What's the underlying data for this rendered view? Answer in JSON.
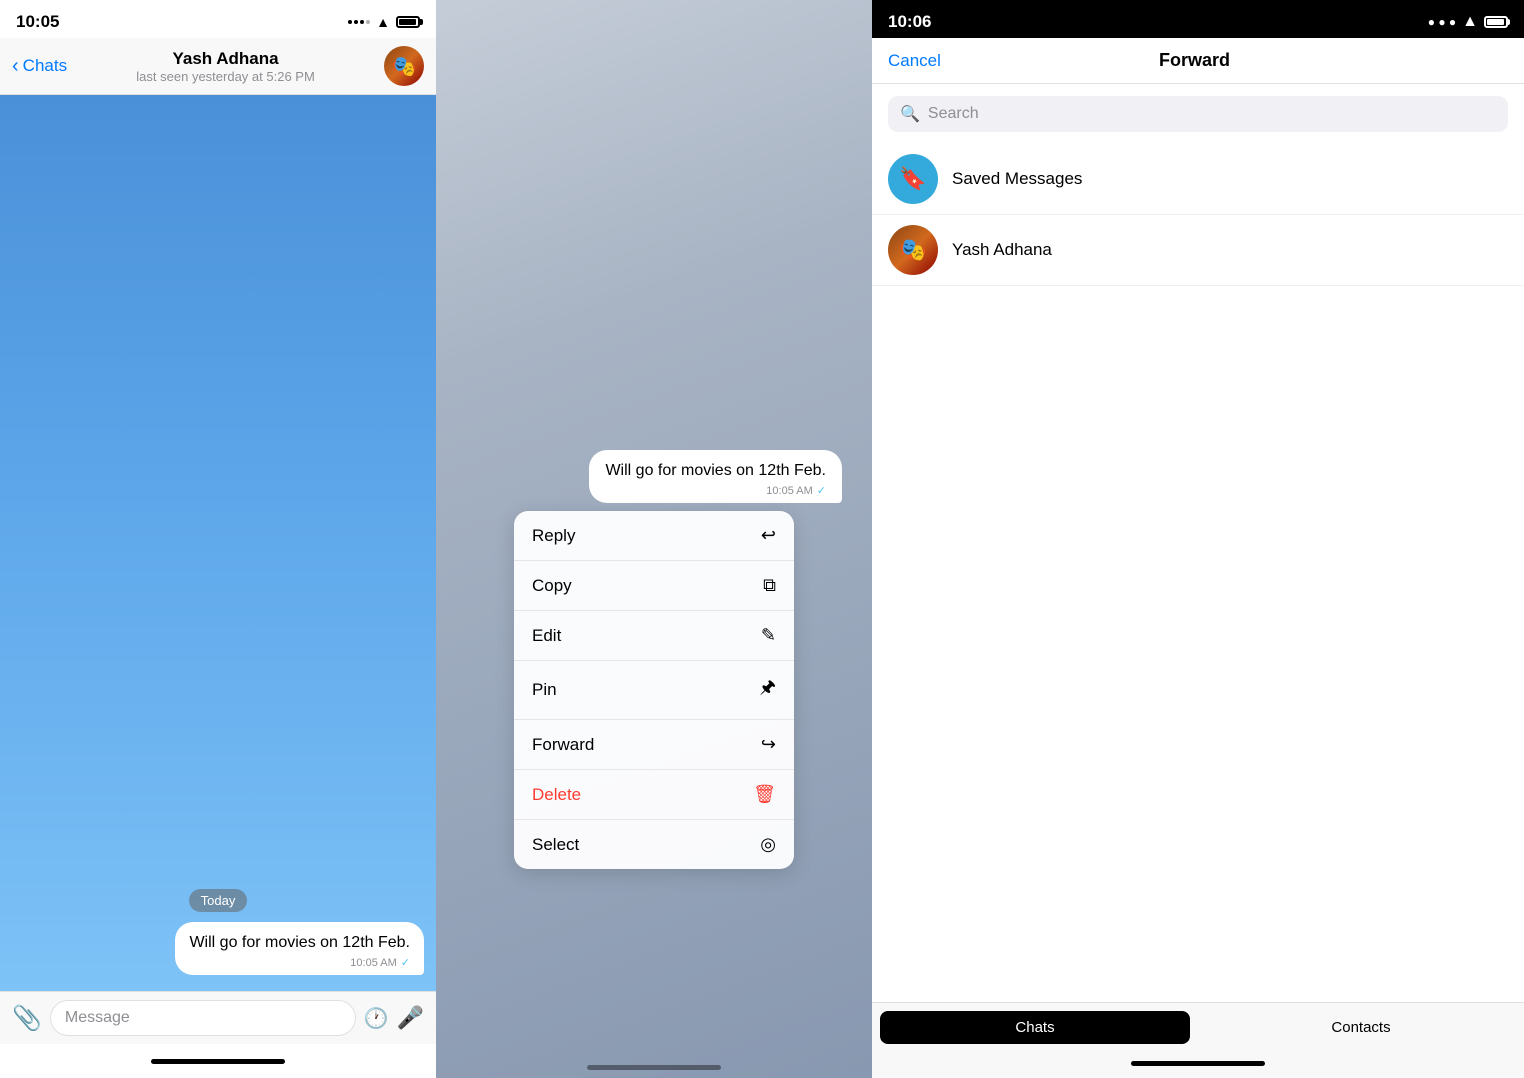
{
  "panel1": {
    "statusBar": {
      "time": "10:05"
    },
    "navBar": {
      "backLabel": "Chats",
      "contactName": "Yash Adhana",
      "contactStatus": "last seen yesterday at 5:26 PM"
    },
    "chat": {
      "dateBadge": "Today",
      "message": "Will go for movies on 12th Feb.",
      "messageTime": "10:05 AM",
      "readCheck": "✓"
    },
    "inputBar": {
      "placeholder": "Message"
    }
  },
  "panel2": {
    "message": "Will go for movies on 12th Feb.",
    "messageTime": "10:05 AM",
    "readCheck": "✓",
    "menuItems": [
      {
        "label": "Reply",
        "icon": "↩",
        "isDelete": false
      },
      {
        "label": "Copy",
        "icon": "⧉",
        "isDelete": false
      },
      {
        "label": "Edit",
        "icon": "✎",
        "isDelete": false
      },
      {
        "label": "Pin",
        "icon": "📌",
        "isDelete": false
      },
      {
        "label": "Forward",
        "icon": "↪",
        "isDelete": false
      },
      {
        "label": "Delete",
        "icon": "🗑",
        "isDelete": true
      },
      {
        "label": "Select",
        "icon": "◎",
        "isDelete": false
      }
    ]
  },
  "panel3": {
    "statusBar": {
      "time": "10:06"
    },
    "navBar": {
      "cancelLabel": "Cancel",
      "title": "Forward"
    },
    "search": {
      "placeholder": "Search"
    },
    "contacts": [
      {
        "type": "saved",
        "name": "Saved Messages"
      },
      {
        "type": "user",
        "name": "Yash Adhana"
      }
    ],
    "tabs": [
      {
        "label": "Chats",
        "active": true
      },
      {
        "label": "Contacts",
        "active": false
      }
    ]
  }
}
